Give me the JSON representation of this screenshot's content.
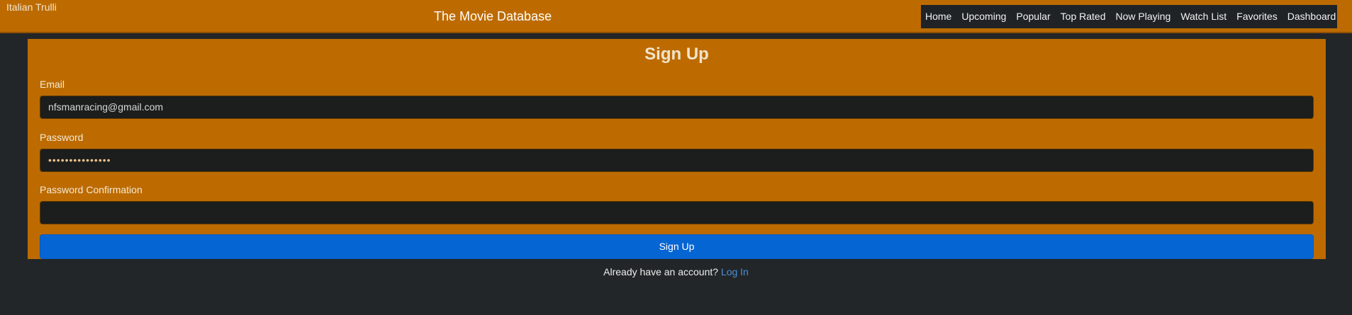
{
  "header": {
    "brand_text": "Italian Trulli",
    "title": "The Movie Database",
    "nav_items": [
      "Home",
      "Upcoming",
      "Popular",
      "Top Rated",
      "Now Playing",
      "Watch List",
      "Favorites",
      "Dashboard"
    ]
  },
  "form": {
    "title": "Sign Up",
    "email_label": "Email",
    "email_value": "nfsmanracing@gmail.com",
    "password_label": "Password",
    "password_value": "•••••••••••••••",
    "password_confirmation_label": "Password Confirmation",
    "password_confirmation_value": "",
    "submit_label": "Sign Up"
  },
  "footer": {
    "prompt": "Already have an account?",
    "login_link": "Log In"
  },
  "colors": {
    "header_bg": "#bd6b00",
    "nav_bg": "#1f2326",
    "page_bg": "#222628",
    "card_bg": "#bd6b00",
    "input_bg": "#1c1d1d",
    "button_bg": "#0565d3",
    "link": "#4c8fdc"
  }
}
